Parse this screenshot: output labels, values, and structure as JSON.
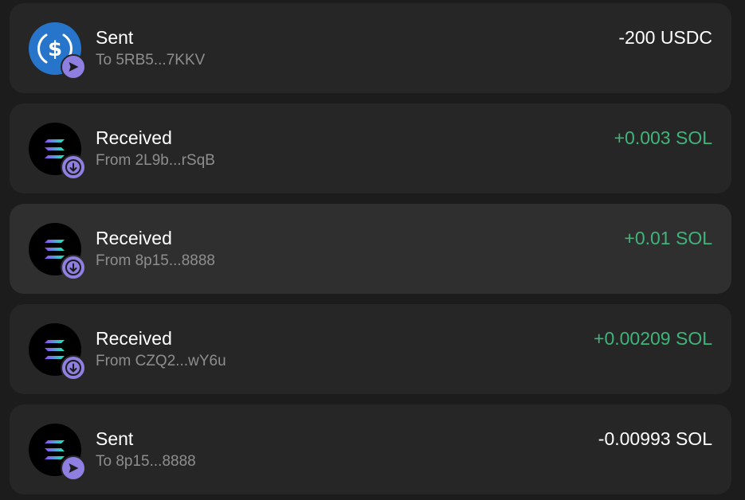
{
  "colors": {
    "positive": "#3fb57a",
    "negative": "#ffffff",
    "badge": "#8f7fe0",
    "usdc": "#2775ca"
  },
  "transactions": [
    {
      "title": "Sent",
      "counterparty": "To 5RB5...7KKV",
      "amount": "-200 USDC",
      "token_icon": "usdc-icon",
      "direction_icon": "send-icon",
      "direction": "sent"
    },
    {
      "title": "Received",
      "counterparty": "From 2L9b...rSqB",
      "amount": "+0.003 SOL",
      "token_icon": "solana-icon",
      "direction_icon": "receive-icon",
      "direction": "received"
    },
    {
      "title": "Received",
      "counterparty": "From 8p15...8888",
      "amount": "+0.01 SOL",
      "token_icon": "solana-icon",
      "direction_icon": "receive-icon",
      "direction": "received"
    },
    {
      "title": "Received",
      "counterparty": "From CZQ2...wY6u",
      "amount": "+0.00209 SOL",
      "token_icon": "solana-icon",
      "direction_icon": "receive-icon",
      "direction": "received"
    },
    {
      "title": "Sent",
      "counterparty": "To 8p15...8888",
      "amount": "-0.00993 SOL",
      "token_icon": "solana-icon",
      "direction_icon": "send-icon",
      "direction": "sent"
    }
  ]
}
